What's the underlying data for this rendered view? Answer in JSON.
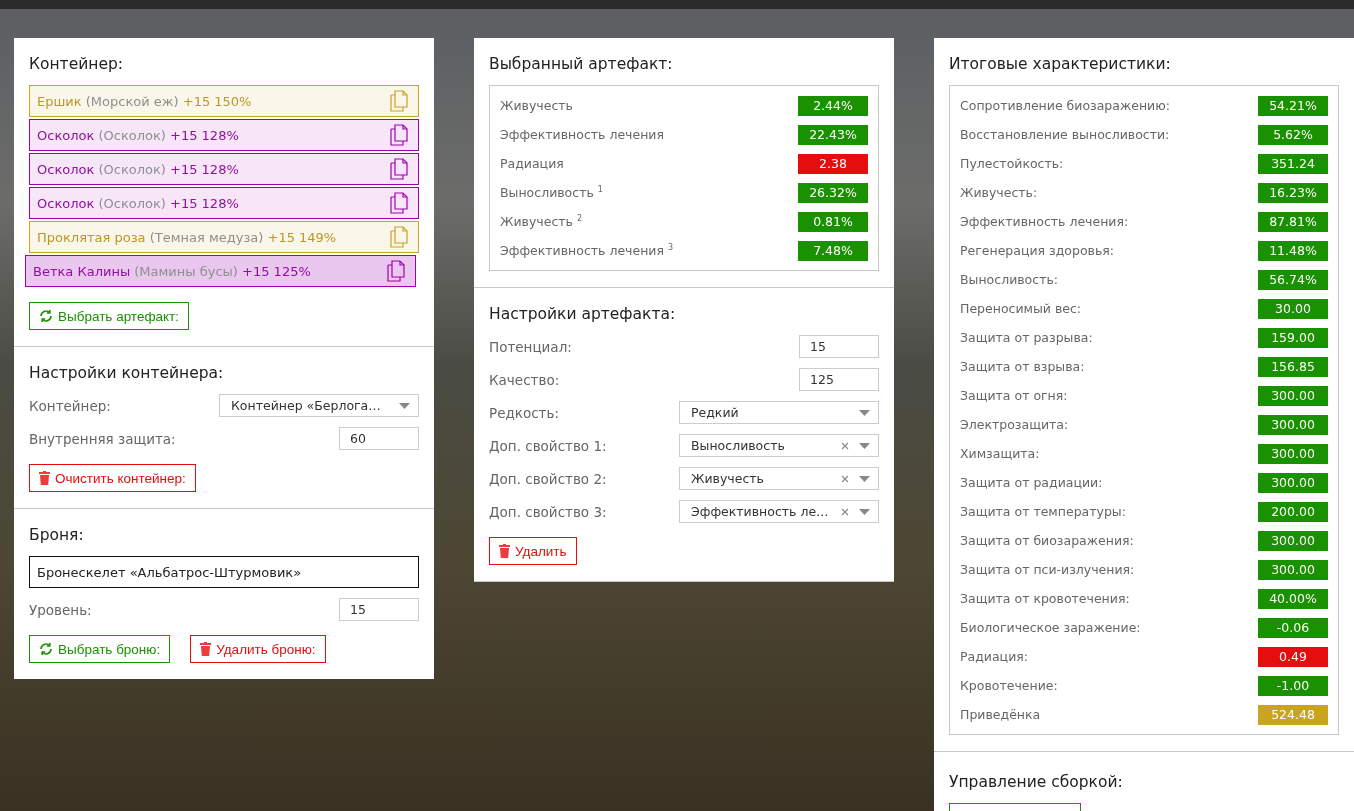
{
  "container_panel": {
    "title": "Контейнер:",
    "artifacts": [
      {
        "name": "Ершик",
        "base": "(Морской еж)",
        "stats": "+15 150%",
        "color": "#c9a420",
        "selected": false
      },
      {
        "name": "Осколок",
        "base": "(Осколок)",
        "stats": "+15 128%",
        "color": "#a000b0",
        "selected": false
      },
      {
        "name": "Осколок",
        "base": "(Осколок)",
        "stats": "+15 128%",
        "color": "#a000b0",
        "selected": false
      },
      {
        "name": "Осколок",
        "base": "(Осколок)",
        "stats": "+15 128%",
        "color": "#a000b0",
        "selected": false
      },
      {
        "name": "Проклятая роза",
        "base": "(Темная медуза)",
        "stats": "+15 149%",
        "color": "#c9a420",
        "selected": false
      },
      {
        "name": "Ветка Калины",
        "base": "(Мамины бусы)",
        "stats": "+15 125%",
        "color": "#a000b0",
        "selected": true
      }
    ],
    "select_button": "Выбрать артефакт:"
  },
  "container_settings": {
    "title": "Настройки контейнера:",
    "fields": [
      {
        "label": "Контейнер:",
        "kind": "select",
        "value": "Контейнер «Берлога…",
        "clearable": false
      },
      {
        "label": "Внутренняя защита:",
        "kind": "input",
        "value": "60"
      }
    ],
    "clear_button": "Очистить контейнер:"
  },
  "armor": {
    "title": "Броня:",
    "name": "Бронескелет «Альбатрос-Штурмовик»",
    "fields": [
      {
        "label": "Уровень:",
        "kind": "input",
        "value": "15"
      }
    ],
    "buttons": [
      {
        "label": "Выбрать броню:",
        "kind": "choose"
      },
      {
        "label": "Удалить броню:",
        "kind": "delete"
      }
    ]
  },
  "selected_artifact": {
    "title": "Выбранный артефакт:",
    "stats": [
      {
        "name": "Живучесть",
        "value": "2.44%",
        "color": "#1a9100"
      },
      {
        "name": "Эффективность лечения",
        "value": "22.43%",
        "color": "#1a9100"
      },
      {
        "name": "Радиация",
        "value": "2.38",
        "color": "#e50d0d"
      },
      {
        "name": "Выносливость $^{1}$",
        "value": "26.32%",
        "color": "#1a9100"
      },
      {
        "name": "Живучесть $^{2}$",
        "value": "0.81%",
        "color": "#1a9100"
      },
      {
        "name": "Эффективность лечения $^{3}$",
        "value": "7.48%",
        "color": "#1a9100"
      }
    ]
  },
  "artifact_settings": {
    "title": "Настройки артефакта:",
    "fields": [
      {
        "label": "Потенциал:",
        "kind": "input",
        "value": "15"
      },
      {
        "label": "Качество:",
        "kind": "input",
        "value": "125"
      },
      {
        "label": "Редкость:",
        "kind": "select",
        "value": "Редкий",
        "clearable": false
      },
      {
        "label": "Доп. свойство 1:",
        "kind": "select",
        "value": "Выносливость",
        "clearable": true
      },
      {
        "label": "Доп. свойство 2:",
        "kind": "select",
        "value": "Живучесть",
        "clearable": true
      },
      {
        "label": "Доп. свойство 3:",
        "kind": "select",
        "value": "Эффективность ле…",
        "clearable": true
      }
    ],
    "delete_button": "Удалить"
  },
  "totals": {
    "title": "Итоговые характеристики:",
    "stats": [
      {
        "name": "Сопротивление биозаражению:",
        "value": "54.21%",
        "color": "#1a9100"
      },
      {
        "name": "Восстановление выносливости:",
        "value": "5.62%",
        "color": "#1a9100"
      },
      {
        "name": "Пулестойкость:",
        "value": "351.24",
        "color": "#1a9100"
      },
      {
        "name": "Живучесть:",
        "value": "16.23%",
        "color": "#1a9100"
      },
      {
        "name": "Эффективность лечения:",
        "value": "87.81%",
        "color": "#1a9100"
      },
      {
        "name": "Регенерация здоровья:",
        "value": "11.48%",
        "color": "#1a9100"
      },
      {
        "name": "Выносливость:",
        "value": "56.74%",
        "color": "#1a9100"
      },
      {
        "name": "Переносимый вес:",
        "value": "30.00",
        "color": "#1a9100"
      },
      {
        "name": "Защита от разрыва:",
        "value": "159.00",
        "color": "#1a9100"
      },
      {
        "name": "Защита от взрыва:",
        "value": "156.85",
        "color": "#1a9100"
      },
      {
        "name": "Защита от огня:",
        "value": "300.00",
        "color": "#1a9100"
      },
      {
        "name": "Электрозащита:",
        "value": "300.00",
        "color": "#1a9100"
      },
      {
        "name": "Химзащита:",
        "value": "300.00",
        "color": "#1a9100"
      },
      {
        "name": "Защита от радиации:",
        "value": "300.00",
        "color": "#1a9100"
      },
      {
        "name": "Защита от температуры:",
        "value": "200.00",
        "color": "#1a9100"
      },
      {
        "name": "Защита от биозаражения:",
        "value": "300.00",
        "color": "#1a9100"
      },
      {
        "name": "Защита от пси-излучения:",
        "value": "300.00",
        "color": "#1a9100"
      },
      {
        "name": "Защита от кровотечения:",
        "value": "40.00%",
        "color": "#1a9100"
      },
      {
        "name": "Биологическое заражение:",
        "value": "-0.06",
        "color": "#1a9100"
      },
      {
        "name": "Радиация:",
        "value": "0.49",
        "color": "#e50d0d"
      },
      {
        "name": "Кровотечение:",
        "value": "-1.00",
        "color": "#1a9100"
      },
      {
        "name": "Приведёнка",
        "value": "524.48",
        "color": "#c9a420"
      }
    ]
  },
  "build_management": {
    "title": "Управление сборкой:"
  }
}
